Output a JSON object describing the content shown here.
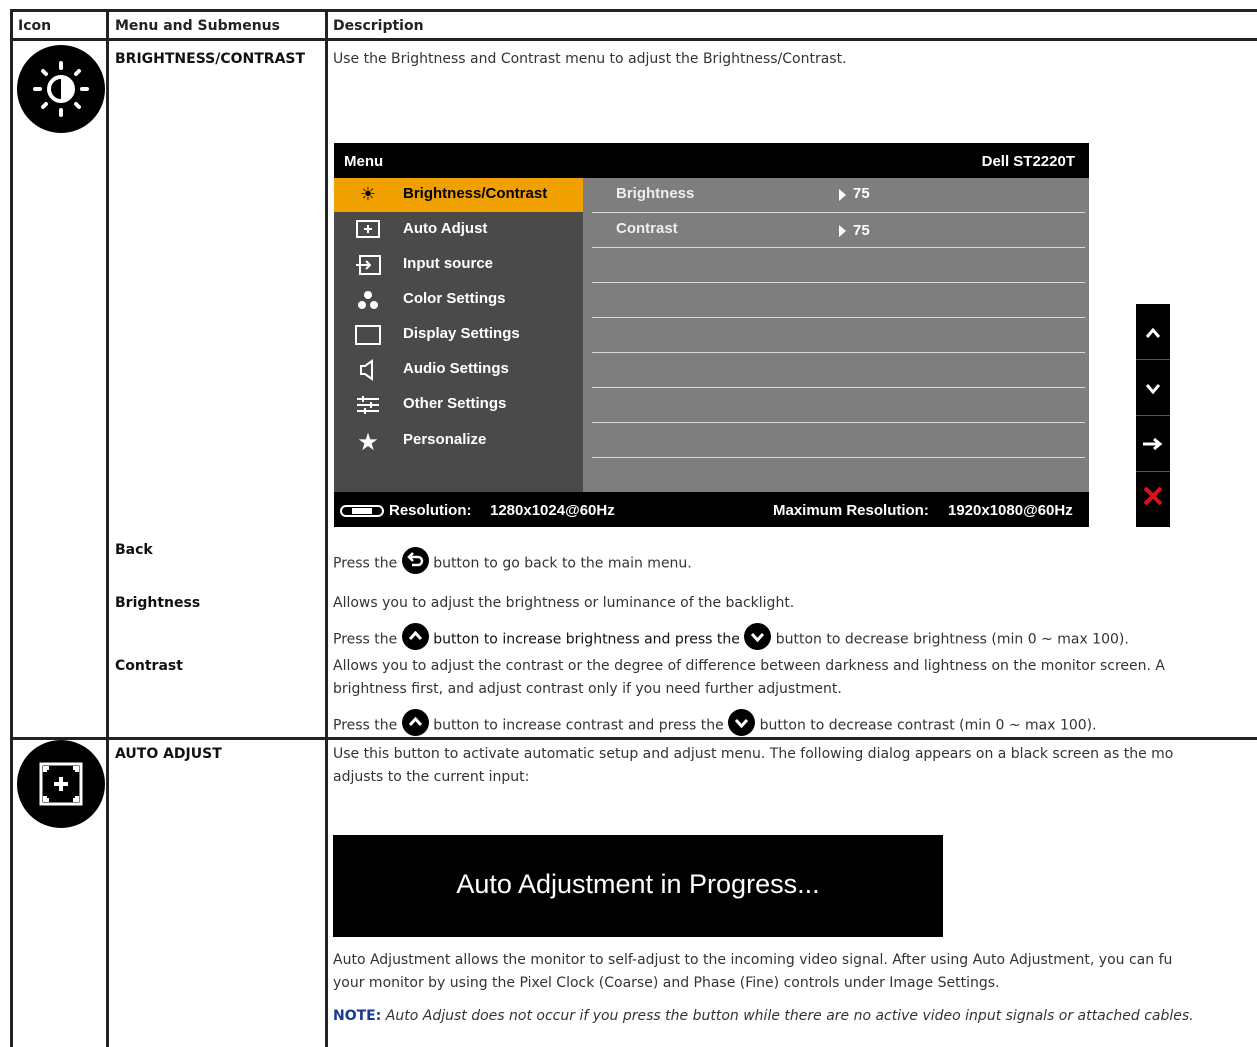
{
  "table": {
    "headers": {
      "icon": "Icon",
      "menu": "Menu and Submenus",
      "description": "Description"
    }
  },
  "brightness_section": {
    "title": "BRIGHTNESS/CONTRAST",
    "description": "Use the Brightness and Contrast menu to adjust the Brightness/Contrast.",
    "icon": "brightness-icon"
  },
  "osd": {
    "menu_label": "Menu",
    "model": "Dell ST2220T",
    "items": [
      {
        "label": "Brightness/Contrast",
        "icon": "brightness-icon"
      },
      {
        "label": "Auto Adjust",
        "icon": "auto-adjust-icon"
      },
      {
        "label": "Input source",
        "icon": "input-source-icon"
      },
      {
        "label": "Color Settings",
        "icon": "color-settings-icon"
      },
      {
        "label": "Display Settings",
        "icon": "display-settings-icon"
      },
      {
        "label": "Audio Settings",
        "icon": "speaker-icon"
      },
      {
        "label": "Other Settings",
        "icon": "sliders-icon"
      },
      {
        "label": "Personalize",
        "icon": "star-icon"
      }
    ],
    "settings": [
      {
        "label": "Brightness",
        "value": "75"
      },
      {
        "label": "Contrast",
        "value": "75"
      }
    ],
    "resolution_label": "Resolution:",
    "resolution_value": "1280x1024@60Hz",
    "max_resolution_label": "Maximum Resolution:",
    "max_resolution_value": "1920x1080@60Hz",
    "nav_buttons": [
      "up-arrow-icon",
      "down-arrow-icon",
      "right-arrow-icon",
      "close-icon"
    ]
  },
  "back": {
    "title": "Back",
    "text_before": "Press the",
    "text_after": "button to go back to the main menu."
  },
  "brightness": {
    "title": "Brightness",
    "line1": "Allows you to adjust the brightness or luminance of the backlight.",
    "line2_a": "Press the",
    "line2_b": "button to increase brightness and press the",
    "line2_c": "button to decrease brightness (min 0 ~ max 100)."
  },
  "contrast": {
    "title": "Contrast",
    "line1": "Allows you to adjust the contrast or the degree of difference between darkness and lightness on the monitor screen. A",
    "line2": "brightness first, and adjust contrast only if you need further adjustment.",
    "line3_a": "Press the",
    "line3_b": "button to increase contrast and press the",
    "line3_c": "button to decrease contrast (min 0 ~ max 100)."
  },
  "auto_adjust": {
    "title": "AUTO ADJUST",
    "line1": "Use this button to activate automatic setup and adjust menu. The following dialog appears on a black screen as the mo",
    "line2": "adjusts to the current input:",
    "dialog_text": "Auto Adjustment in Progress...",
    "line3": "Auto Adjustment allows the monitor to self-adjust to the incoming video signal. After using Auto Adjustment, you can fu",
    "line4": "your monitor by using the Pixel Clock (Coarse) and Phase (Fine) controls under Image Settings.",
    "note_label": "NOTE:",
    "note_text": "Auto Adjust does not occur if you press the button while there are no active video input signals or attached cables."
  }
}
